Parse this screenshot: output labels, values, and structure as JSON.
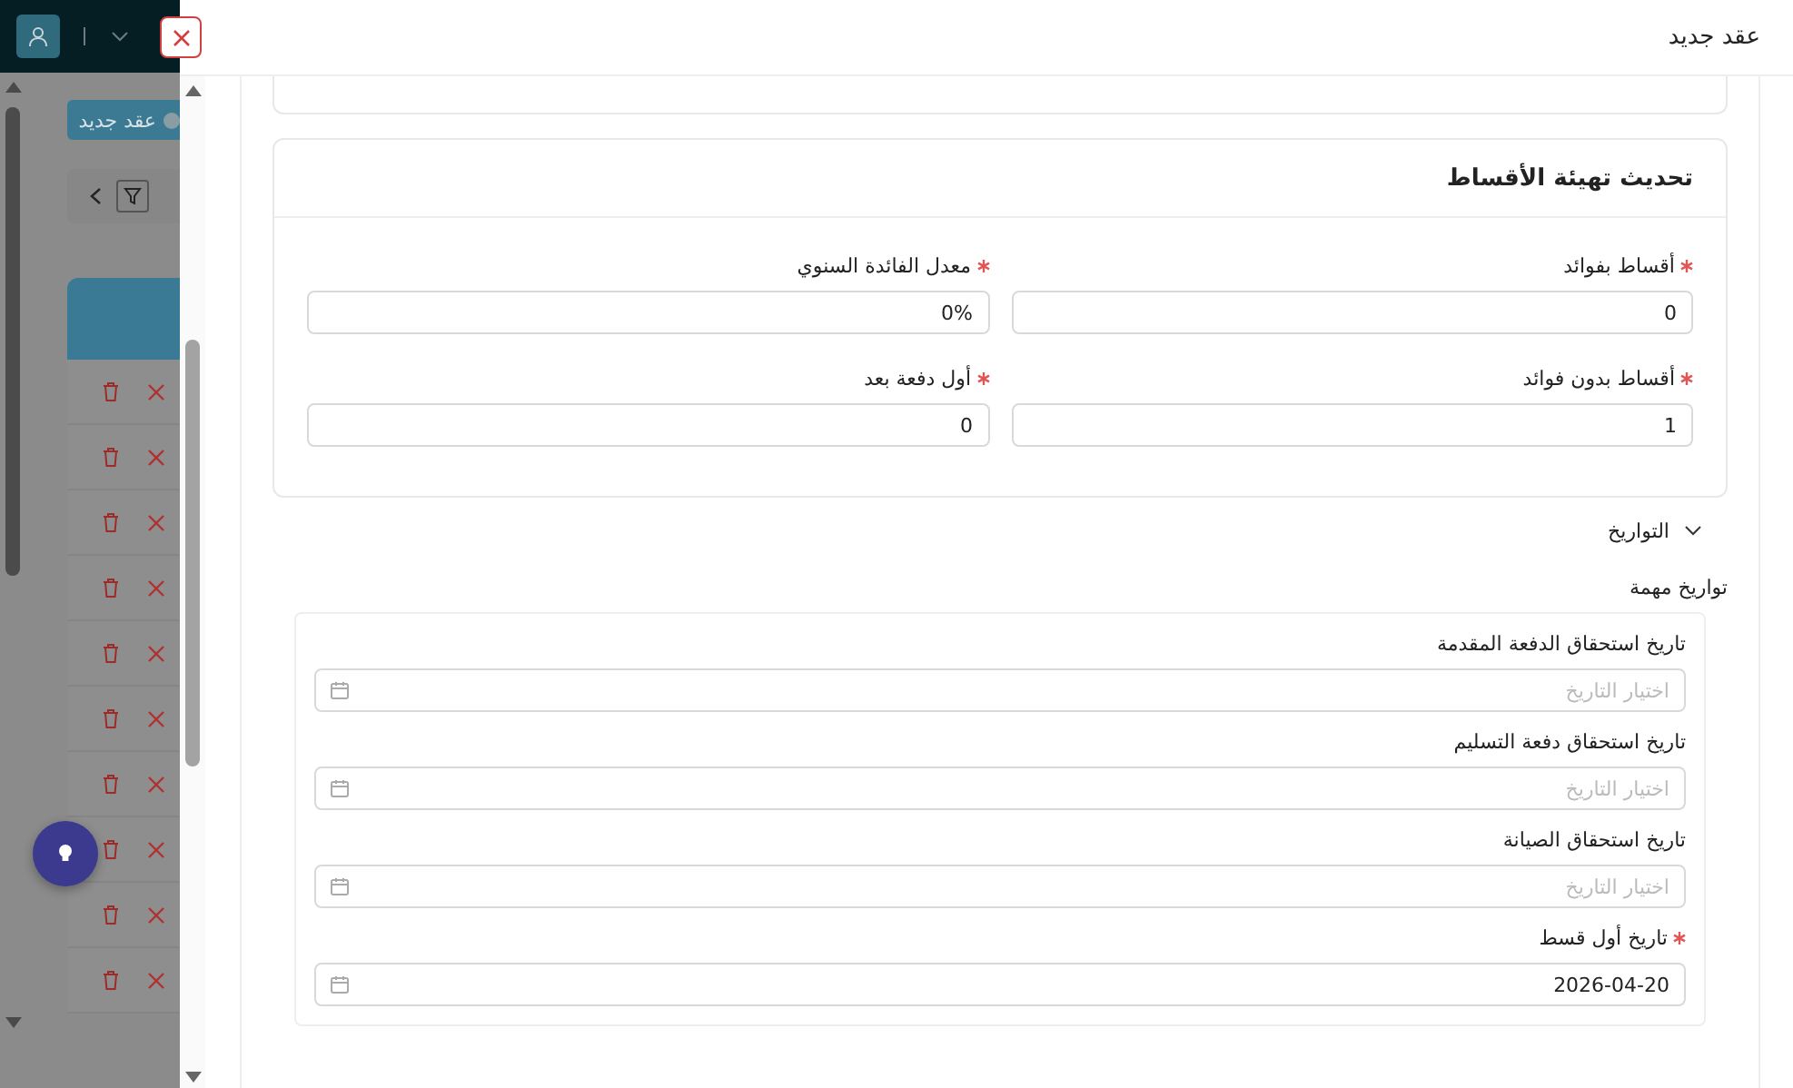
{
  "background_page": {
    "new_contract_button": "عقد جديد"
  },
  "drawer": {
    "title": "عقد جديد"
  },
  "installments_section": {
    "title": "تحديث تهيئة الأقساط",
    "fields": [
      {
        "label": "أقساط بفوائد",
        "value": "0",
        "required": true
      },
      {
        "label": "معدل الفائدة السنوي",
        "value": "0%",
        "required": true
      },
      {
        "label": "أقساط بدون فوائد",
        "value": "1",
        "required": true
      },
      {
        "label": "أول دفعة بعد",
        "value": "0",
        "required": true
      }
    ]
  },
  "dates_toggle": {
    "label": "التواريخ",
    "expanded": true
  },
  "important_dates": {
    "title": "تواريخ مهمة",
    "fields": [
      {
        "label": "تاريخ استحقاق الدفعة المقدمة",
        "placeholder": "اختيار التاريخ",
        "required": false
      },
      {
        "label": "تاريخ استحقاق دفعة التسليم",
        "placeholder": "اختيار التاريخ",
        "required": false
      },
      {
        "label": "تاريخ استحقاق الصيانة",
        "placeholder": "اختيار التاريخ",
        "required": false
      },
      {
        "label": "تاريخ أول قسط",
        "value": "2026-04-20",
        "required": true
      }
    ]
  }
}
